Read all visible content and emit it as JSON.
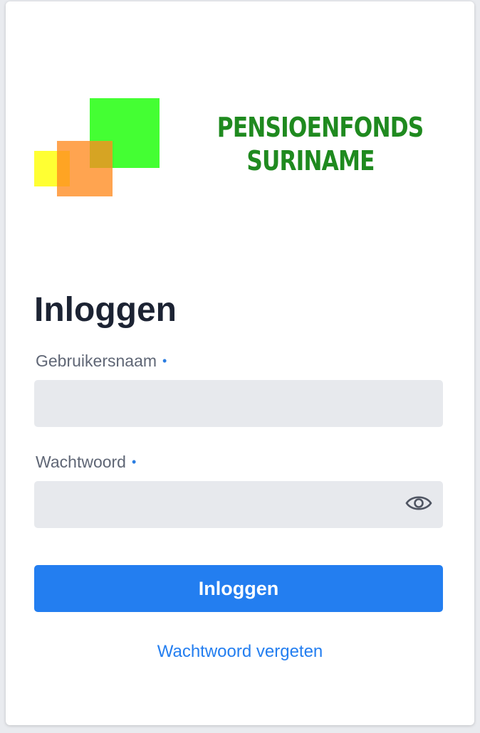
{
  "logo": {
    "line1": "PENSIOENFONDS",
    "line2": "SURINAME",
    "text_color": "#1f8a1f",
    "colors": {
      "green": "#44ff33",
      "yellow": "#ffff33",
      "orange": "#ff8a1f"
    }
  },
  "form": {
    "title": "Inloggen",
    "username": {
      "label": "Gebruikersnaam",
      "required_marker": "•",
      "value": ""
    },
    "password": {
      "label": "Wachtwoord",
      "required_marker": "•",
      "value": "",
      "toggle_icon": "eye-icon"
    },
    "submit_label": "Inloggen",
    "forgot_link": "Wachtwoord vergeten"
  },
  "colors": {
    "accent": "#237ef0",
    "input_bg": "#e7e9ed",
    "heading": "#1c2333",
    "label": "#5f6675"
  }
}
